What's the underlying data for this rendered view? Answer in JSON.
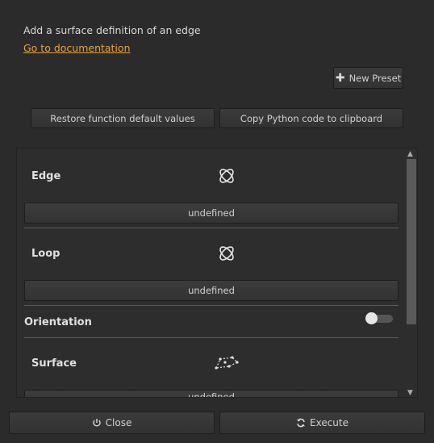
{
  "header": {
    "description": "Add a surface definition of an edge",
    "doc_link": "Go to documentation"
  },
  "toolbar": {
    "new_preset": "New Preset",
    "restore_defaults": "Restore function default values",
    "copy_python": "Copy Python code to clipboard"
  },
  "params": {
    "edge": {
      "label": "Edge",
      "value": "undefined",
      "icon": "edge-select-icon"
    },
    "loop": {
      "label": "Loop",
      "value": "undefined",
      "icon": "loop-select-icon"
    },
    "orientation": {
      "label": "Orientation",
      "enabled": false
    },
    "surface": {
      "label": "Surface",
      "value": "undefined",
      "icon": "surface-select-icon"
    }
  },
  "footer": {
    "close": "Close",
    "execute": "Execute"
  },
  "colors": {
    "background": "#2b2b2b",
    "link": "#e8a33a"
  }
}
